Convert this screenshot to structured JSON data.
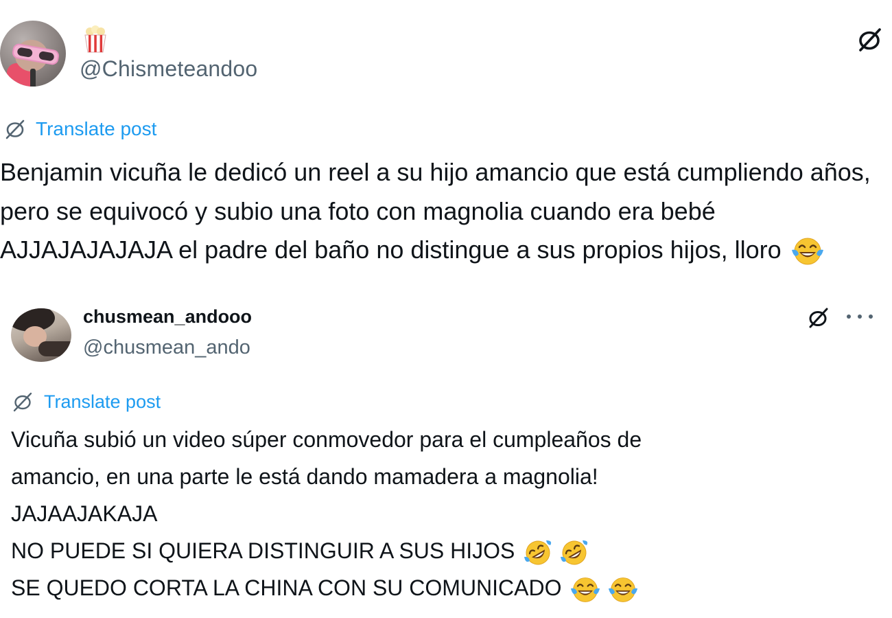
{
  "post1": {
    "avatar": "profile-avatar",
    "name_icon": "popcorn-icon",
    "handle": "@Chismeteandoo",
    "grok_icon": "grok-icon",
    "translate_label": "Translate post",
    "body_text": "Benjamin vicuña le dedicó un reel a su hijo amancio que está cumpliendo años, pero se equivocó y subio una foto con magnolia cuando era bebé AJJAJAJAJAJA el padre del baño no distingue a sus propios hijos, lloro",
    "body_emojis": [
      "tears-of-joy-emoji"
    ]
  },
  "post2": {
    "avatar": "profile-avatar",
    "display_name": "chusmean_andooo",
    "handle": "@chusmean_ando",
    "grok_icon": "grok-icon",
    "more_icon": "more-options-icon",
    "translate_label": "Translate post",
    "lines": [
      "Vicuña subió un video súper conmovedor para el cumpleaños de",
      "amancio, en una parte le está dando mamadera a magnolia!",
      "JAJAAJAKAJA",
      "NO PUEDE SI QUIERA DISTINGUIR A SUS HIJOS",
      "SE QUEDO CORTA LA CHINA CON SU COMUNICADO"
    ],
    "line4_emojis": [
      "rolling-laughing-emoji",
      "rolling-laughing-emoji"
    ],
    "line5_emojis": [
      "tears-of-joy-emoji",
      "tears-of-joy-emoji"
    ]
  },
  "colors": {
    "text": "#0f1419",
    "secondary": "#536471",
    "link": "#1d9bf0",
    "emoji_face": "#f7c531"
  }
}
